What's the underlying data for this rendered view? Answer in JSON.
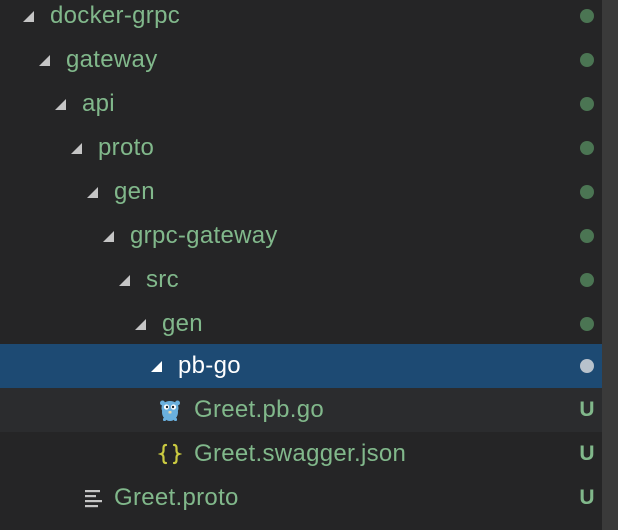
{
  "colors": {
    "background": "#252526",
    "folder_text": "#81b88b",
    "selected_text": "#ffffff",
    "selected_bg": "#1d4a73",
    "hover_bg": "#2b2c2e",
    "status_dot": "#4b7553",
    "status_dot_selected": "#b8c2cc",
    "untracked": "#81b88b",
    "gopher_icon": "#6ab0de",
    "json_icon": "#cbcb41",
    "text_icon": "#c5c5c5"
  },
  "tree": {
    "items": [
      {
        "label": "docker-grpc",
        "kind": "folder",
        "expanded": true,
        "status": "dot"
      },
      {
        "label": "gateway",
        "kind": "folder",
        "expanded": true,
        "status": "dot"
      },
      {
        "label": "api",
        "kind": "folder",
        "expanded": true,
        "status": "dot"
      },
      {
        "label": "proto",
        "kind": "folder",
        "expanded": true,
        "status": "dot"
      },
      {
        "label": "gen",
        "kind": "folder",
        "expanded": true,
        "status": "dot"
      },
      {
        "label": "grpc-gateway",
        "kind": "folder",
        "expanded": true,
        "status": "dot"
      },
      {
        "label": "src",
        "kind": "folder",
        "expanded": true,
        "status": "dot"
      },
      {
        "label": "gen",
        "kind": "folder",
        "expanded": true,
        "status": "dot"
      },
      {
        "label": "pb-go",
        "kind": "folder",
        "expanded": true,
        "status": "dot",
        "selected": true
      },
      {
        "label": "Greet.pb.go",
        "kind": "file",
        "icon": "go-gopher-icon",
        "status": "U",
        "hovered": true
      },
      {
        "label": "Greet.swagger.json",
        "kind": "file",
        "icon": "json-braces-icon",
        "status": "U"
      },
      {
        "label": "Greet.proto",
        "kind": "file",
        "icon": "text-lines-icon",
        "status": "U"
      }
    ]
  }
}
